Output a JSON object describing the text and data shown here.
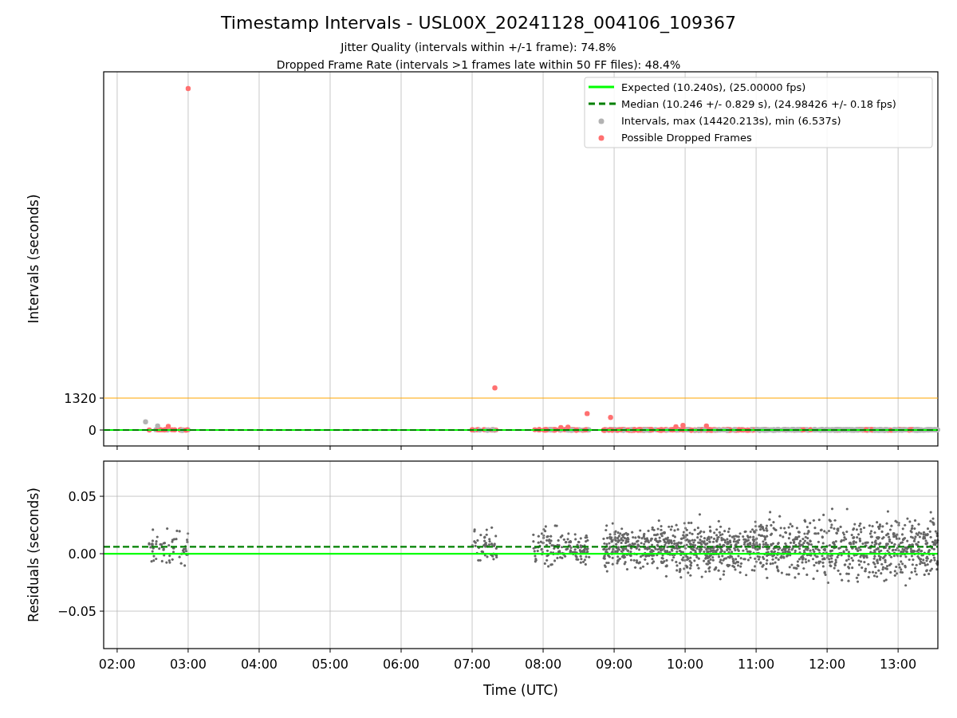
{
  "figure": {
    "title": "Timestamp Intervals - USL00X_20241128_004106_109367",
    "subtitles": [
      "Jitter Quality (intervals within +/-1 frame): 74.8%",
      "Dropped Frame Rate (intervals >1 frames late within 50 FF files): 48.4%"
    ]
  },
  "intervals_plot": {
    "chart_data": {
      "type": "scatter",
      "ylabel": "Intervals (seconds)",
      "xlim": [
        1.81,
        13.56
      ],
      "ylim": [
        -660,
        14817
      ],
      "grid": true,
      "yticks": [
        {
          "value": 0,
          "label": "0"
        },
        {
          "value": 1320,
          "label": "1320"
        }
      ]
    },
    "legend": [
      {
        "kind": "line",
        "label": "Expected (10.240s), (25.00000 fps)",
        "color": "#00ff00"
      },
      {
        "kind": "dashed",
        "label": "Median (10.246 +/- 0.829 s), (24.98426 +/- 0.18 fps)",
        "color": "#008000"
      },
      {
        "kind": "dot",
        "label": "Intervals, max (14420.213s), min (6.537s)",
        "color": "#b3b3b3"
      },
      {
        "kind": "dot",
        "label": "Possible Dropped Frames",
        "color": "#ff7070"
      }
    ]
  },
  "residuals_plot": {
    "chart_data": {
      "type": "line",
      "xlabel": "Time (UTC)",
      "ylabel": "Residuals (seconds)",
      "x": [
        1.81,
        13.56
      ],
      "xlim": [
        1.81,
        13.56
      ],
      "ylim": [
        -0.0826,
        0.0806
      ],
      "grid": true,
      "xticks": [
        {
          "value": 2,
          "label": "02:00"
        },
        {
          "value": 3,
          "label": "03:00"
        },
        {
          "value": 4,
          "label": "04:00"
        },
        {
          "value": 5,
          "label": "05:00"
        },
        {
          "value": 6,
          "label": "06:00"
        },
        {
          "value": 7,
          "label": "07:00"
        },
        {
          "value": 8,
          "label": "08:00"
        },
        {
          "value": 9,
          "label": "09:00"
        },
        {
          "value": 10,
          "label": "10:00"
        },
        {
          "value": 11,
          "label": "11:00"
        },
        {
          "value": 12,
          "label": "12:00"
        },
        {
          "value": 13,
          "label": "13:00"
        }
      ],
      "yticks": [
        {
          "value": 0.05,
          "label": "0.05"
        },
        {
          "value": 0,
          "label": "0.00"
        },
        {
          "value": -0.05,
          "label": "−0.05"
        }
      ],
      "series": [
        {
          "color": "#00ff00",
          "line_style": "solid",
          "values": [
            0,
            0
          ]
        },
        {
          "color": "#008000",
          "line_style": "dashed",
          "values": [
            0.006,
            0.006
          ]
        }
      ]
    }
  }
}
